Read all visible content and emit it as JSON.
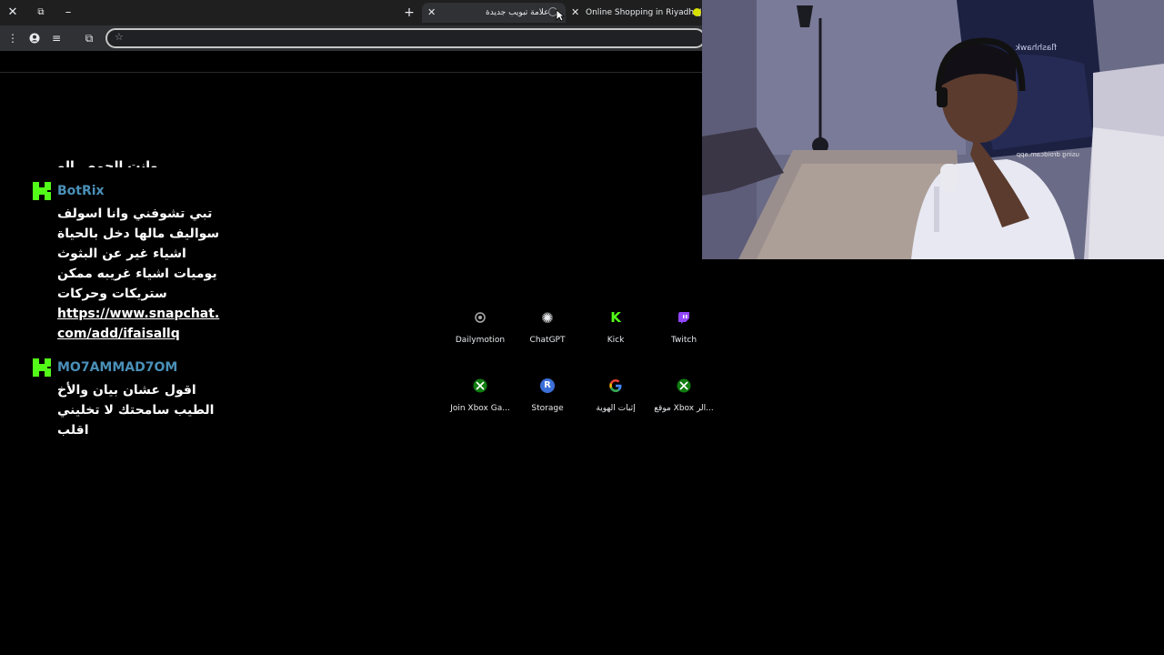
{
  "window_controls": {
    "close": "✕",
    "restore": "⧉",
    "minimize": "–"
  },
  "new_tab": "+",
  "tabs": [
    {
      "label": "علامة تبويب جديدة",
      "close": "✕",
      "active": true
    },
    {
      "label": "Online Shopping in Riyadh, Jed",
      "close": "✕",
      "active": false
    }
  ],
  "toolbar": {
    "menu": "⋮",
    "profile": "●",
    "reading_list": "≡",
    "extensions": "⧉",
    "bookmark_star": "☆"
  },
  "chat": {
    "cut_off_text": "وانت الحمص الو",
    "messages": [
      {
        "badge": "K",
        "username": "BotRix",
        "lines": [
          "تبي تشوفني وانا اسولف",
          "سواليف مالها دخل بالحياة",
          "اشياء غير عن البثوث",
          "يوميات اشياء غريبه ممكن",
          "ستريكات وحركات"
        ],
        "link_lines": [
          "https://www.snapchat.",
          "com/add/ifaisallq"
        ]
      },
      {
        "badge": "K",
        "username": "MO7AMMAD7OM",
        "lines": [
          "اقول عشان بيان والأخ",
          "الطيب سامحتك لا تخليني",
          "اقلب"
        ]
      }
    ]
  },
  "shortcuts": [
    {
      "label": "Dailymotion",
      "icon": "dailymotion-icon",
      "glyph": "d",
      "color": "#3a3a3a"
    },
    {
      "label": "ChatGPT",
      "icon": "chatgpt-icon",
      "glyph": "✺",
      "color": "#000000"
    },
    {
      "label": "Kick",
      "icon": "kick-icon",
      "glyph": "K",
      "color": "#53fc18"
    },
    {
      "label": "Twitch",
      "icon": "twitch-icon",
      "glyph": "▮",
      "color": "#9146ff"
    },
    {
      "label": "Join Xbox Ga...",
      "icon": "xbox-icon",
      "glyph": "✕",
      "color": "#107c10"
    },
    {
      "label": "Storage",
      "icon": "storage-icon",
      "glyph": "R",
      "color": "#3c6fd8"
    },
    {
      "label": "إثبات الهوية",
      "icon": "google-icon",
      "glyph": "G",
      "color": "#ffffff"
    },
    {
      "label": "موقع Xbox الر...",
      "icon": "xbox-icon",
      "glyph": "✕",
      "color": "#107c10"
    }
  ],
  "webcam": {
    "chair_brand": "flashhawk",
    "watermark": "using droidcam.app"
  }
}
